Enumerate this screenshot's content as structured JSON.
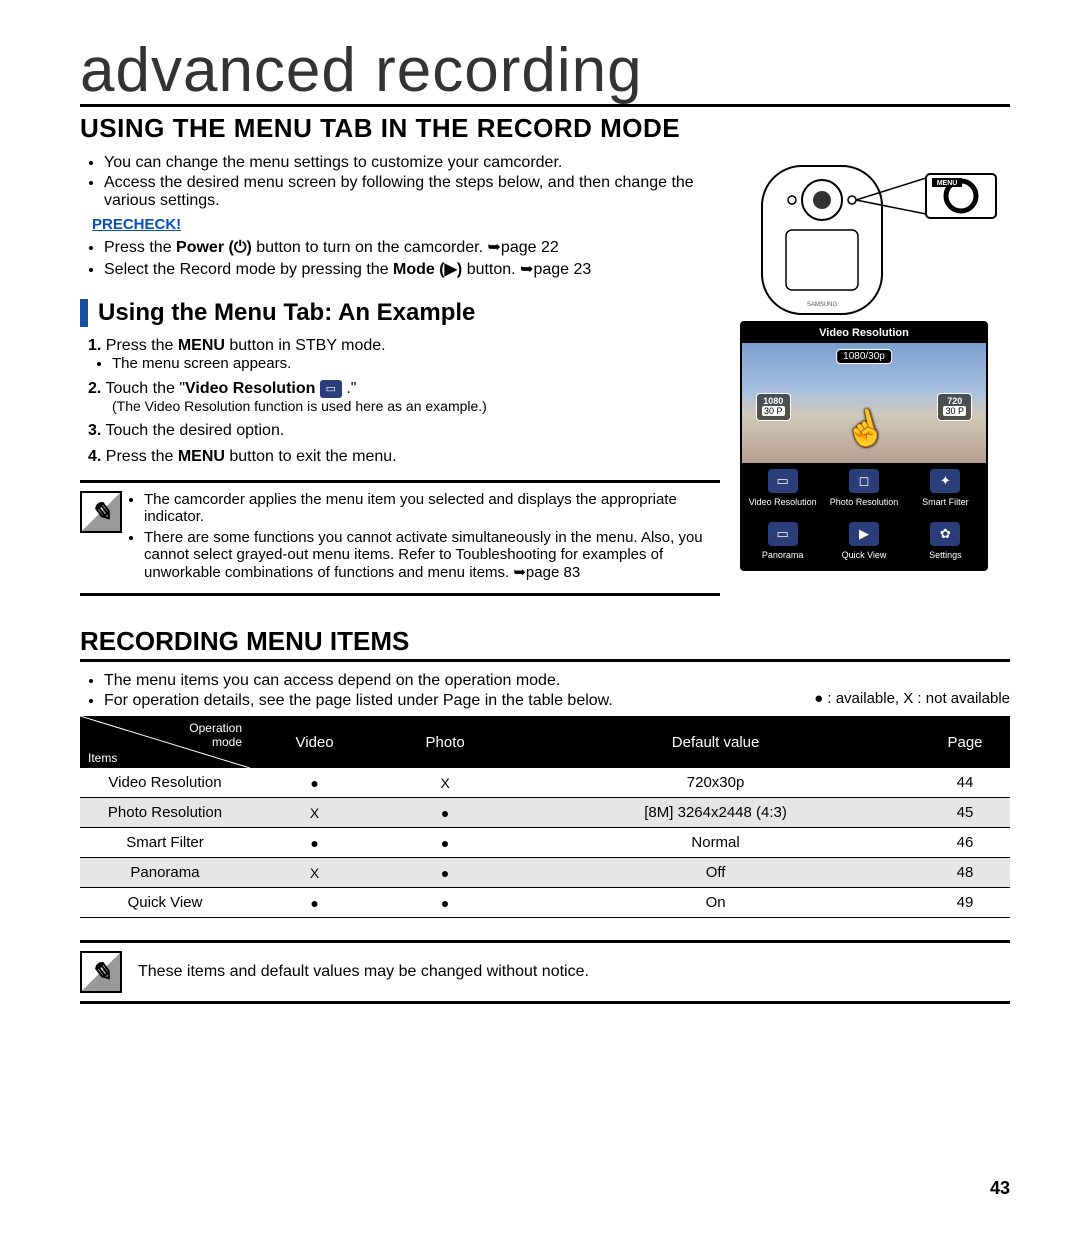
{
  "page_title": "advanced recording",
  "heading1": "USING THE MENU TAB IN THE RECORD MODE",
  "intro_bullets": [
    "You can change the menu settings to customize your camcorder.",
    "Access the desired menu screen by following the steps below, and then change the various settings."
  ],
  "precheck_label": "PRECHECK!",
  "precheck_items": [
    {
      "pre": "Press the ",
      "bold1": "Power (⏻)",
      "post": " button to turn on the camcorder. ➥page 22"
    },
    {
      "pre": "Select the Record mode by pressing the ",
      "bold1": "Mode (▶)",
      "post": " button. ➥page 23"
    }
  ],
  "h2": "Using the Menu Tab: An Example",
  "steps": [
    {
      "n": "1.",
      "pre": "Press the ",
      "bold": "MENU",
      "post": " button in STBY mode.",
      "sub": "The menu screen appears."
    },
    {
      "n": "2.",
      "pre": "Touch the \"",
      "bold": "Video Resolution",
      "post": " .\"",
      "note": "(The Video Resolution function is used here as an example.)"
    },
    {
      "n": "3.",
      "pre": "Touch the desired option.",
      "bold": "",
      "post": ""
    },
    {
      "n": "4.",
      "pre": "Press the ",
      "bold": "MENU",
      "post": " button to exit the menu."
    }
  ],
  "note_items": [
    "The camcorder applies the menu item you selected and displays the appropriate indicator.",
    "There are some functions you cannot activate simultaneously in the menu. Also, you cannot select grayed-out menu items. Refer to Toubleshooting for examples of unworkable combinations of functions and menu items. ➥page 83"
  ],
  "camcorder_label": "MENU",
  "screen": {
    "title": "Video Resolution",
    "badge": "1080/30p",
    "option_left": {
      "l1": "1080",
      "l2": "30 P"
    },
    "option_right": {
      "l1": "720",
      "l2": "30 P"
    },
    "menu_items": [
      {
        "icon": "▭",
        "label": "Video Resolution"
      },
      {
        "icon": "◻",
        "label": "Photo Resolution"
      },
      {
        "icon": "✦",
        "label": "Smart Filter"
      },
      {
        "icon": "▭",
        "label": "Panorama"
      },
      {
        "icon": "▶",
        "label": "Quick View"
      },
      {
        "icon": "✿",
        "label": "Settings"
      }
    ]
  },
  "heading2": "RECORDING MENU ITEMS",
  "h2_bullets": [
    "The menu items you can access depend on the operation mode.",
    "For operation details, see the page listed under Page in the table below."
  ],
  "legend": "● : available, X : not available",
  "table": {
    "header_first_top": "Operation mode",
    "header_first_bottom": "Items",
    "headers": [
      "Video",
      "Photo",
      "Default value",
      "Page"
    ],
    "rows": [
      {
        "item": "Video Resolution",
        "video": "●",
        "photo": "X",
        "default": "720x30p",
        "page": "44"
      },
      {
        "item": "Photo Resolution",
        "video": "X",
        "photo": "●",
        "default": "[8M] 3264x2448 (4:3)",
        "page": "45"
      },
      {
        "item": "Smart Filter",
        "video": "●",
        "photo": "●",
        "default": "Normal",
        "page": "46"
      },
      {
        "item": "Panorama",
        "video": "X",
        "photo": "●",
        "default": "Off",
        "page": "48"
      },
      {
        "item": "Quick View",
        "video": "●",
        "photo": "●",
        "default": "On",
        "page": "49"
      }
    ]
  },
  "footer_note": "These items and default values may be changed without notice.",
  "page_number": "43"
}
